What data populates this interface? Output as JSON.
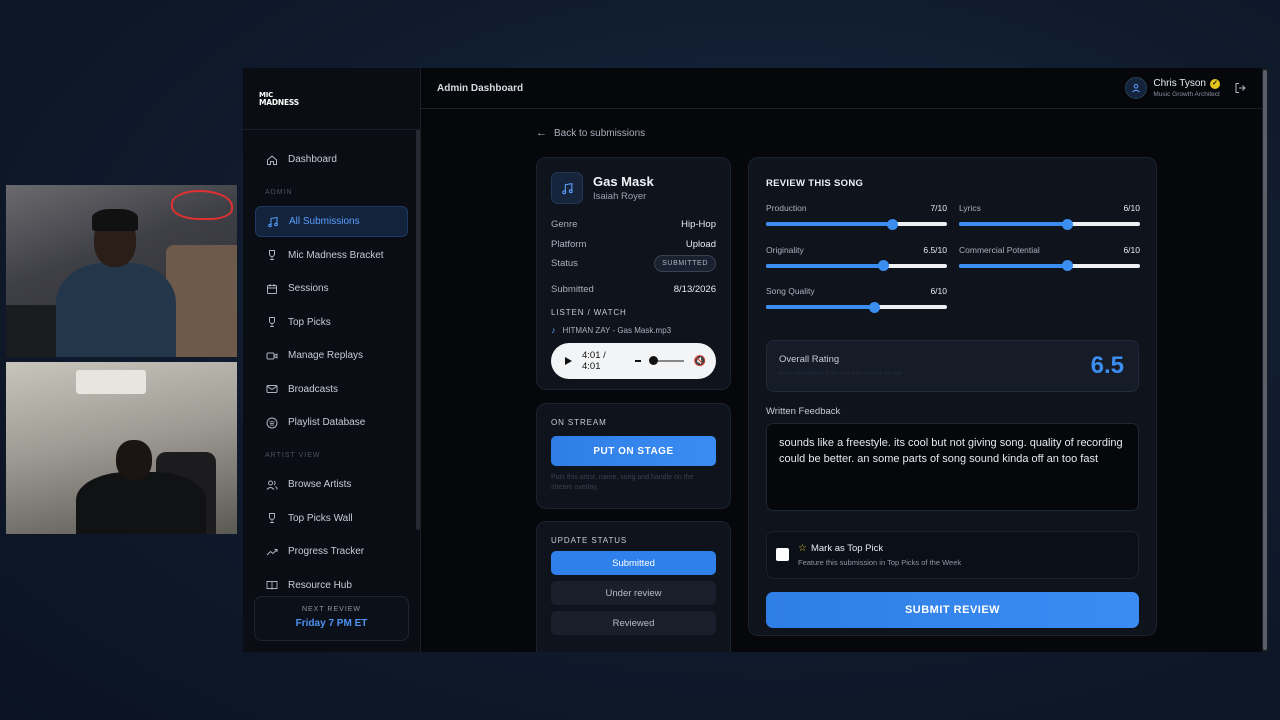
{
  "colors": {
    "accent": "#3b8df0",
    "background": "#05070b",
    "verified": "#e5c41b"
  },
  "logo": {
    "line1": "MIC",
    "line2": "MADNESS"
  },
  "sidebar": {
    "section_admin": "ADMIN",
    "section_artist": "ARTIST VIEW",
    "items": [
      {
        "label": "Dashboard",
        "icon": "home-icon"
      },
      {
        "label": "All Submissions",
        "icon": "music-note-icon",
        "active": true
      },
      {
        "label": "Mic Madness Bracket",
        "icon": "trophy-icon"
      },
      {
        "label": "Sessions",
        "icon": "calendar-icon"
      },
      {
        "label": "Top Picks",
        "icon": "trophy-icon"
      },
      {
        "label": "Manage Replays",
        "icon": "video-icon"
      },
      {
        "label": "Broadcasts",
        "icon": "mail-icon"
      },
      {
        "label": "Playlist Database",
        "icon": "spotify-icon"
      }
    ],
    "artist_items": [
      {
        "label": "Browse Artists",
        "icon": "users-icon"
      },
      {
        "label": "Top Picks Wall",
        "icon": "trophy-icon"
      },
      {
        "label": "Progress Tracker",
        "icon": "trend-icon"
      },
      {
        "label": "Resource Hub",
        "icon": "book-icon"
      }
    ],
    "next_review": {
      "label": "NEXT REVIEW",
      "value": "Friday 7 PM ET"
    }
  },
  "header": {
    "title": "Admin Dashboard",
    "user_name": "Chris Tyson",
    "user_role": "Music Growth Architect"
  },
  "back_link": "Back to submissions",
  "song": {
    "title": "Gas Mask",
    "artist": "Isaiah Royer",
    "genre_label": "Genre",
    "genre": "Hip-Hop",
    "platform_label": "Platform",
    "platform": "Upload",
    "status_label": "Status",
    "status": "SUBMITTED",
    "submitted_label": "Submitted",
    "submitted": "8/13/2026",
    "listen_label": "LISTEN / WATCH",
    "file_name": "HITMAN ZAY - Gas Mask.mp3",
    "player_time": "4:01 / 4:01"
  },
  "on_stream": {
    "label": "ON STREAM",
    "button": "PUT ON STAGE",
    "hint": "Puts this artist, name, song and handle on the stream overlay."
  },
  "update_status": {
    "label": "UPDATE STATUS",
    "options": [
      "Submitted",
      "Under review",
      "Reviewed"
    ],
    "selected": 0
  },
  "review": {
    "title": "REVIEW THIS SONG",
    "sliders": [
      {
        "label": "Production",
        "display": "7/10",
        "value": 7,
        "max": 10
      },
      {
        "label": "Lyrics",
        "display": "6/10",
        "value": 6,
        "max": 10
      },
      {
        "label": "Originality",
        "display": "6.5/10",
        "value": 6.5,
        "max": 10
      },
      {
        "label": "Commercial Potential",
        "display": "6/10",
        "value": 6,
        "max": 10
      },
      {
        "label": "Song Quality",
        "display": "6/10",
        "value": 6,
        "max": 10
      }
    ],
    "overall_label": "Overall Rating",
    "overall_sub": "Auto-calculated from the five scores above",
    "overall_value": "6.5",
    "feedback_label": "Written Feedback",
    "feedback": "sounds like a freestyle. its cool but not giving song. quality of recording could be better. an some parts of song sound kinda off an too fast",
    "top_pick_label": "Mark as Top Pick",
    "top_pick_sub": "Feature this submission in Top Picks of the Week",
    "submit": "SUBMIT REVIEW"
  }
}
